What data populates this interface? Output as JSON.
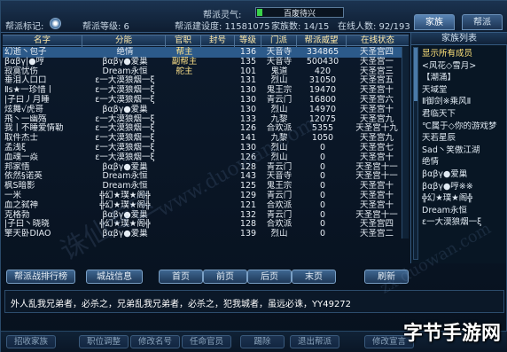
{
  "top": {
    "guild_label": "帮派标记:",
    "level_label": "帮派等级: 6",
    "spirit_label": "帮派灵气:",
    "spirit_value": "百废待兴",
    "build_label": "帮派建设度: 11581075",
    "family_label": "家族数: 14/15",
    "online_label": "在线人数: 92/193",
    "tabs": [
      {
        "label": "家族",
        "active": true
      },
      {
        "label": "帮派",
        "active": false
      }
    ]
  },
  "table": {
    "columns": [
      "名字",
      "分能",
      "官职",
      "封号",
      "等级",
      "门派",
      "帮派威望",
      "在线状态"
    ],
    "rows": [
      {
        "name": "幻逝丶包子",
        "title": "绝情",
        "post": "帮主",
        "rank": "",
        "level": "136",
        "school": "天音寺",
        "contrib": "334865",
        "status": "天圣宫四",
        "sel": true
      },
      {
        "name": "βαβγ|●哼",
        "title": "βαβγ●爱巢",
        "post": "副帮主",
        "rank": "",
        "level": "135",
        "school": "天音寺",
        "contrib": "500430",
        "status": "天圣宫一",
        "sel": false
      },
      {
        "name": "寂寞忧伤",
        "title": "Dream永恒",
        "post": "舵主",
        "rank": "",
        "level": "101",
        "school": "鬼道",
        "contrib": "420",
        "status": "天圣宫三",
        "sel": false
      },
      {
        "name": "垂泪人口口",
        "title": "ε一大漠狼烟一ξ",
        "post": "",
        "rank": "",
        "level": "131",
        "school": "烈山",
        "contrib": "31050",
        "status": "天圣宫五",
        "sel": false
      },
      {
        "name": "Ⅱs★一珍惜丨",
        "title": "ε一大漠狼烟一ξ",
        "post": "",
        "rank": "",
        "level": "130",
        "school": "鬼王宗",
        "contrib": "19470",
        "status": "天圣宫十",
        "sel": false
      },
      {
        "name": "|子曰丿月睡",
        "title": "ε一大漠狼烟一ξ",
        "post": "",
        "rank": "",
        "level": "130",
        "school": "青云门",
        "contrib": "16800",
        "status": "天圣宫六",
        "sel": false
      },
      {
        "name": "炫舞√虎哥",
        "title": "βαβγ●爱巢",
        "post": "",
        "rank": "",
        "level": "130",
        "school": "烈山",
        "contrib": "14970",
        "status": "天圣宫十",
        "sel": false
      },
      {
        "name": "飛丶一幽殇",
        "title": "ε一大漠狼烟一ξ",
        "post": "",
        "rank": "",
        "level": "133",
        "school": "九黎",
        "contrib": "12075",
        "status": "天圣宫九",
        "sel": false
      },
      {
        "name": "我丨不睡爱情勒",
        "title": "ε一大漠狼烟一ξ",
        "post": "",
        "rank": "",
        "level": "126",
        "school": "合欢派",
        "contrib": "5355",
        "status": "天圣宫十九",
        "sel": false
      },
      {
        "name": "取件杰士",
        "title": "ε一大漠狼烟一ξ",
        "post": "",
        "rank": "",
        "level": "141",
        "school": "九黎",
        "contrib": "1050",
        "status": "天圣宫九",
        "sel": false
      },
      {
        "name": "孟浅ξ",
        "title": "ε一大漠狼烟一ξ",
        "post": "",
        "rank": "",
        "level": "130",
        "school": "烈山",
        "contrib": "0",
        "status": "天圣宫七",
        "sel": false
      },
      {
        "name": "血魂一焱",
        "title": "ε一大漠狼烟一ξ",
        "post": "",
        "rank": "",
        "level": "126",
        "school": "烈山",
        "contrib": "0",
        "status": "天圣宫十",
        "sel": false
      },
      {
        "name": "邦家悟",
        "title": "βαβγ●爱巢",
        "post": "",
        "rank": "",
        "level": "128",
        "school": "青云门",
        "contrib": "0",
        "status": "天圣宫十一",
        "sel": false
      },
      {
        "name": "依然§诺英",
        "title": "Dream永恒",
        "post": "",
        "rank": "",
        "level": "143",
        "school": "天音寺",
        "contrib": "0",
        "status": "天圣宫十一",
        "sel": false
      },
      {
        "name": "枫S暗影",
        "title": "Dream永恒",
        "post": "",
        "rank": "",
        "level": "125",
        "school": "鬼王宗",
        "contrib": "0",
        "status": "天圣宫十",
        "sel": false
      },
      {
        "name": "一米",
        "title": "╬幻★璞★阁╬",
        "post": "",
        "rank": "",
        "level": "129",
        "school": "青云门",
        "contrib": "0",
        "status": "天圣宫十",
        "sel": false
      },
      {
        "name": "血之弑神",
        "title": "╬幻★璞★阁╬",
        "post": "",
        "rank": "",
        "level": "121",
        "school": "合欢派",
        "contrib": "0",
        "status": "天圣宫十",
        "sel": false
      },
      {
        "name": "克格勃",
        "title": "βαβγ●爱巢",
        "post": "",
        "rank": "",
        "level": "132",
        "school": "青云门",
        "contrib": "0",
        "status": "天圣宫十一",
        "sel": false
      },
      {
        "name": "|子曰丶晓晓",
        "title": "╬幻★璞★阁╬",
        "post": "",
        "rank": "",
        "level": "128",
        "school": "合欢派",
        "contrib": "0",
        "status": "天圣宫四",
        "sel": false
      },
      {
        "name": "擎天卧DIAO",
        "title": "βαβγ●爱巢",
        "post": "",
        "rank": "",
        "level": "139",
        "school": "烈山",
        "contrib": "0",
        "status": "天圣宫二",
        "sel": false
      }
    ]
  },
  "family_list": {
    "title": "家族列表",
    "items": [
      {
        "label": "显示所有成员",
        "hl": true
      },
      {
        "label": "<风花◇雪月>",
        "hl": false
      },
      {
        "label": "【潮涌】",
        "hl": false
      },
      {
        "label": "天域堂",
        "hl": false
      },
      {
        "label": "Ⅱ御剑※乘风Ⅱ",
        "hl": false
      },
      {
        "label": "君临天下",
        "hl": false
      },
      {
        "label": "℃属于◇你的游戏梦",
        "hl": false
      },
      {
        "label": "天若星辰",
        "hl": false
      },
      {
        "label": "Sad丶笑傲江湖",
        "hl": false
      },
      {
        "label": "绝情",
        "hl": false
      },
      {
        "label": "βαβγ●爱巢",
        "hl": false
      },
      {
        "label": "βαβγ●哼※※",
        "hl": false
      },
      {
        "label": "╬幻★璞★阁╬",
        "hl": false
      },
      {
        "label": "Dream永恒",
        "hl": false
      },
      {
        "label": "ε一大漠狼烟一ξ",
        "hl": false
      }
    ]
  },
  "buttons": {
    "ranking": "帮派战排行榜",
    "battle_info": "城战信息",
    "first": "首页",
    "prev": "前页",
    "next": "后页",
    "last": "末页",
    "refresh": "刷新"
  },
  "message": "外人乱我兄弟者，必杀之，兄弟乱我兄弟者，必杀之，犯我城者，虽远必诛，YY49272",
  "bottom": {
    "b1": "招收家族",
    "b2": "职位调整",
    "b3": "修改名号",
    "b4": "任命官员",
    "b5": "踢除",
    "b6": "退出帮派",
    "b7": "修改宣言"
  },
  "watermark": {
    "site": "www.duowan.com",
    "site2": "zx.duowan.com",
    "game": "诛仙专区"
  },
  "brand": "字节手游网"
}
